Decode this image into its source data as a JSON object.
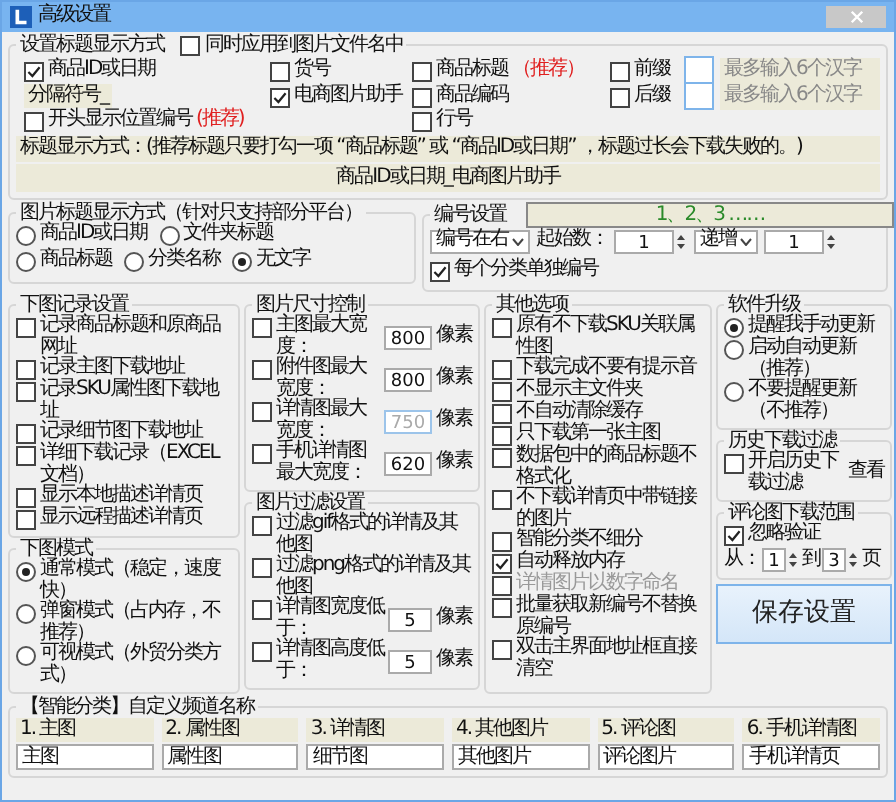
{
  "window": {
    "title": "高级设置"
  },
  "title_format": {
    "legend": "设置标题显示方式",
    "apply_to_filename": {
      "label": "同时应用到图片文件名中",
      "checked": false
    },
    "rows": [
      [
        {
          "kind": "checkbox",
          "label": "商品ID或日期",
          "checked": true
        },
        {
          "kind": "checkbox",
          "label": "货号",
          "checked": false
        },
        {
          "kind": "checkbox",
          "label": "商品标题",
          "checked": false,
          "tag": "（推荐）"
        },
        {
          "kind": "affix",
          "label": "前缀",
          "checked": false,
          "hint": "最多输入6个汉字"
        }
      ],
      [
        {
          "kind": "label",
          "label": "分隔符号_"
        },
        {
          "kind": "checkbox",
          "label": "电商图片助手",
          "checked": true
        },
        {
          "kind": "checkbox",
          "label": "商品编码",
          "checked": false
        },
        {
          "kind": "affix",
          "label": "后缀",
          "checked": false,
          "hint": "最多输入6个汉字"
        }
      ],
      [
        {
          "kind": "checkbox",
          "label": "开头显示位置编号",
          "checked": false,
          "tag": "(推荐)"
        },
        "",
        {
          "kind": "checkbox",
          "label": "行号",
          "checked": false
        }
      ]
    ],
    "note": "标题显示方式：(推荐标题只要打勾一项 “商品标题” 或 “商品ID或日期” ，标题过长会下载失败的。)",
    "preview": "商品ID或日期_电商图片助手"
  },
  "image_title": {
    "legend": "图片标题显示方式（针对只支持部分平台）",
    "options": [
      {
        "label": "商品ID或日期",
        "selected": false
      },
      {
        "label": "文件夹标题",
        "selected": false
      },
      {
        "label": "商品标题",
        "selected": false
      },
      {
        "label": "分类名称",
        "selected": false
      },
      {
        "label": "无文字",
        "selected": true
      }
    ]
  },
  "numbering": {
    "legend": "编号设置",
    "preview": "1、2、3 ……",
    "position": "编号在右",
    "start_label": "起始数：",
    "start": "1",
    "mode": "递增",
    "step": "1",
    "per_category": {
      "label": "每个分类单独编号",
      "checked": true
    }
  },
  "download_log": {
    "legend": "下图记录设置",
    "items": [
      {
        "label": "记录商品标题和原商品网址",
        "checked": false
      },
      {
        "label": "记录主图下载地址",
        "checked": false
      },
      {
        "label": "记录SKU属性图下载地址",
        "checked": false
      },
      {
        "label": "记录细节图下载地址",
        "checked": false
      },
      {
        "label": "详细下载记录（EXCEL文档）",
        "checked": false
      },
      {
        "label": "显示本地描述详情页",
        "checked": false
      },
      {
        "label": "显示远程描述详情页",
        "checked": false
      }
    ]
  },
  "download_mode": {
    "legend": "下图模式",
    "options": [
      {
        "label": "通常模式（稳定，速度快）",
        "selected": true
      },
      {
        "label": "弹窗模式（占内存，不推荐）",
        "selected": false
      },
      {
        "label": "可视模式（外贸分类方式）",
        "selected": false
      }
    ]
  },
  "size_control": {
    "legend": "图片尺寸控制",
    "items": [
      {
        "label": "主图最大宽度：",
        "checked": false,
        "value": "800",
        "unit": "像素",
        "disabled": false
      },
      {
        "label": "附件图最大宽度：",
        "checked": false,
        "value": "800",
        "unit": "像素",
        "disabled": false
      },
      {
        "label": "详情图最大宽度：",
        "checked": false,
        "value": "750",
        "unit": "像素",
        "disabled": true
      },
      {
        "label": "手机详情图最大宽度：",
        "checked": false,
        "value": "620",
        "unit": "像素",
        "disabled": false
      }
    ]
  },
  "filter": {
    "legend": "图片过滤设置",
    "items": [
      {
        "kind": "checkbox",
        "label": "过滤gif格式的详情及其他图",
        "checked": false
      },
      {
        "kind": "checkbox",
        "label": "过滤png格式的详情及其他图",
        "checked": false
      },
      {
        "kind": "input",
        "label": "详情图宽度低于：",
        "checked": false,
        "value": "5",
        "unit": "像素"
      },
      {
        "kind": "input",
        "label": "详情图高度低于：",
        "checked": false,
        "value": "5",
        "unit": "像素"
      }
    ]
  },
  "other": {
    "legend": "其他选项",
    "items": [
      {
        "label": "原有不下载SKU关联属性图",
        "checked": false,
        "disabled": false
      },
      {
        "label": "下载完成不要有提示音",
        "checked": false,
        "disabled": false
      },
      {
        "label": "不显示主文件夹",
        "checked": false,
        "disabled": false
      },
      {
        "label": "不自动清除缓存",
        "checked": false,
        "disabled": false
      },
      {
        "label": "只下载第一张主图",
        "checked": false,
        "disabled": false
      },
      {
        "label": "数据包中的商品标题不格式化",
        "checked": false,
        "disabled": false
      },
      {
        "label": "不下载详情页中带链接的图片",
        "checked": false,
        "disabled": false
      },
      {
        "label": "智能分类不细分",
        "checked": false,
        "disabled": false
      },
      {
        "label": "自动释放内存",
        "checked": true,
        "disabled": false
      },
      {
        "label": "详情图片以数字命名",
        "checked": false,
        "disabled": true
      },
      {
        "label": "批量获取新编号不替换原编号",
        "checked": false,
        "disabled": false
      },
      {
        "label": "双击主界面地址框直接清空",
        "checked": false,
        "disabled": false
      }
    ]
  },
  "upgrade": {
    "legend": "软件升级",
    "options": [
      {
        "label": "提醒我手动更新",
        "selected": true
      },
      {
        "label": "启动自动更新（推荐）",
        "selected": false
      },
      {
        "label": "不要提醒更新（不推荐）",
        "selected": false
      }
    ]
  },
  "history": {
    "legend": "历史下载过滤",
    "enable": {
      "label": "开启历史下载过滤",
      "checked": false
    },
    "view_link": "查看"
  },
  "comments": {
    "legend": "评论图下载范围",
    "ignore": {
      "label": "忽略验证",
      "checked": true
    },
    "from_label": "从：",
    "from": "1",
    "to_label": "到",
    "to": "3",
    "unit": "页"
  },
  "save_button": "保存设置",
  "channels": {
    "legend": "【智能分类】自定义频道名称",
    "items": [
      {
        "label": "1. 主图",
        "value": "主图"
      },
      {
        "label": "2. 属性图",
        "value": "属性图"
      },
      {
        "label": "3. 详情图",
        "value": "细节图"
      },
      {
        "label": "4. 其他图片",
        "value": "其他图片"
      },
      {
        "label": "5. 评论图",
        "value": "评论图片"
      },
      {
        "label": "6. 手机详情图",
        "value": "手机详情页"
      }
    ]
  }
}
